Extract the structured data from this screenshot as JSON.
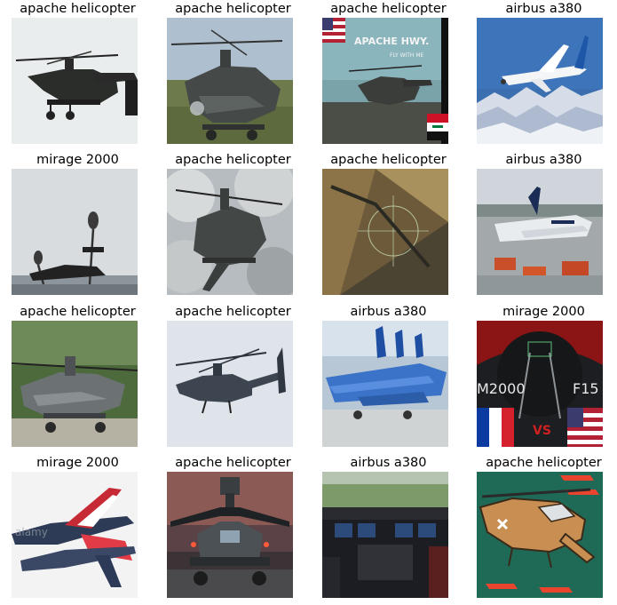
{
  "grid": {
    "rows": 4,
    "columns": 4,
    "cells": [
      {
        "label": "apache helicopter",
        "scene": "apache-sky"
      },
      {
        "label": "apache helicopter",
        "scene": "apache-ground"
      },
      {
        "label": "apache helicopter",
        "scene": "apache-poster",
        "poster_title": "APACHE HWY.",
        "poster_subtitle": "FLY WITH ME"
      },
      {
        "label": "airbus a380",
        "scene": "a380-mountains"
      },
      {
        "label": "mirage 2000",
        "scene": "mirage-mirrors"
      },
      {
        "label": "apache helicopter",
        "scene": "apache-smoke"
      },
      {
        "label": "apache helicopter",
        "scene": "apache-hud"
      },
      {
        "label": "airbus a380",
        "scene": "a380-airport"
      },
      {
        "label": "apache helicopter",
        "scene": "apache-parked"
      },
      {
        "label": "apache helicopter",
        "scene": "apache-flying"
      },
      {
        "label": "airbus a380",
        "scene": "a380-blue"
      },
      {
        "label": "mirage 2000",
        "scene": "mirage-versus",
        "left_text": "M2000",
        "right_text": "F15",
        "vs_text": "VS"
      },
      {
        "label": "mirage 2000",
        "scene": "mirage-jets"
      },
      {
        "label": "apache helicopter",
        "scene": "apache-front"
      },
      {
        "label": "airbus a380",
        "scene": "a380-cockpit"
      },
      {
        "label": "apache helicopter",
        "scene": "apache-cartoon"
      }
    ]
  }
}
